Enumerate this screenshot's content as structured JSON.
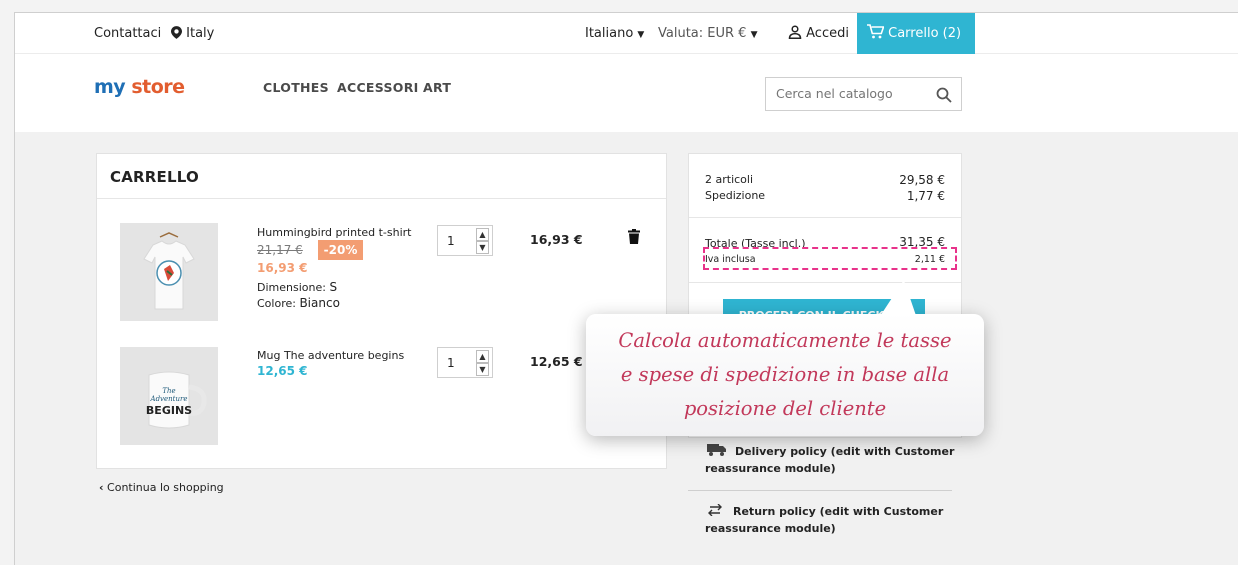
{
  "topbar": {
    "contact": "Contattaci",
    "location": "Italy",
    "language": "Italiano",
    "currency": "Valuta: EUR €",
    "login": "Accedi",
    "cart": "Carrello (2)"
  },
  "header": {
    "logo_my": "my",
    "logo_store": "store",
    "nav": [
      "CLOTHES",
      "ACCESSORI",
      "ART"
    ],
    "search_placeholder": "Cerca nel catalogo"
  },
  "cart": {
    "title": "CARRELLO",
    "items": [
      {
        "name": "Hummingbird printed t-shirt",
        "old_price": "21,17 €",
        "discount": "-20%",
        "price": "16,93 €",
        "size_label": "Dimensione:",
        "size": "S",
        "color_label": "Colore:",
        "color": "Bianco",
        "qty": "1",
        "total": "16,93 €"
      },
      {
        "name": "Mug The adventure begins",
        "price": "12,65 €",
        "qty": "1",
        "total": "12,65 €"
      }
    ],
    "continue": "Continua lo shopping"
  },
  "summary": {
    "items_label": "2 articoli",
    "items_value": "29,58 €",
    "shipping_label": "Spedizione",
    "shipping_value": "1,77 €",
    "total_label": "Totale (Tasse incl.)",
    "total_value": "31,35 €",
    "vat_label": "Iva inclusa",
    "vat_value": "2,11 €",
    "checkout": "PROCEDI CON IL CHECKOUT",
    "delivery": "Delivery policy (edit with Customer reassurance module)",
    "return": "Return policy (edit with Customer reassurance module)"
  },
  "callout": {
    "line1": "Calcola automaticamente le tasse",
    "line2": "e spese di spedizione in base alla",
    "line3": "posizione del cliente"
  },
  "colors": {
    "accent": "#2fb5d2",
    "discount": "#f39d72",
    "highlight": "#e8328a",
    "callout_text": "#c2385a"
  }
}
